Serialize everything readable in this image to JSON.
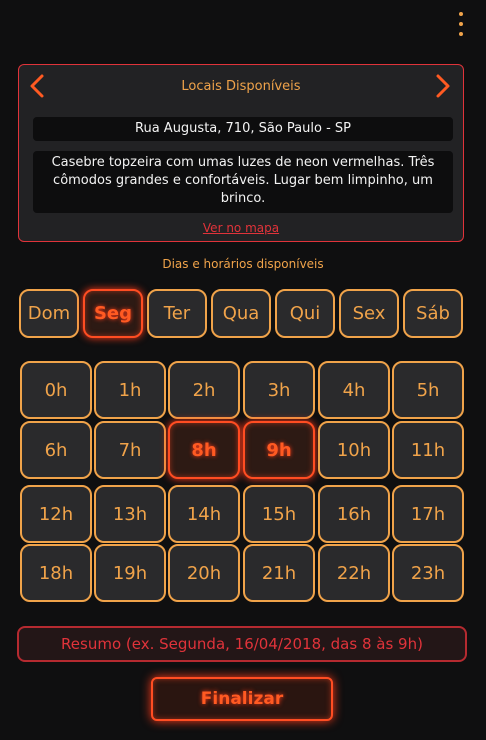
{
  "header": {
    "menu_icon": "kebab-menu-icon"
  },
  "locations": {
    "title": "Locais Disponíveis",
    "prev_icon": "chevron-left-icon",
    "next_icon": "chevron-right-icon",
    "address": "Rua Augusta, 710, São Paulo - SP",
    "description": "Casebre topzeira com umas luzes de neon vermelhas. Três cômodos grandes e confortáveis. Lugar bem limpinho, um brinco.",
    "map_link": "Ver no mapa"
  },
  "schedule": {
    "label": "Dias e horários disponíveis",
    "days": [
      {
        "label": "Dom",
        "selected": false
      },
      {
        "label": "Seg",
        "selected": true
      },
      {
        "label": "Ter",
        "selected": false
      },
      {
        "label": "Qua",
        "selected": false
      },
      {
        "label": "Qui",
        "selected": false
      },
      {
        "label": "Sex",
        "selected": false
      },
      {
        "label": "Sáb",
        "selected": false
      }
    ],
    "hours": [
      {
        "label": "0h",
        "selected": false
      },
      {
        "label": "1h",
        "selected": false
      },
      {
        "label": "2h",
        "selected": false
      },
      {
        "label": "3h",
        "selected": false
      },
      {
        "label": "4h",
        "selected": false
      },
      {
        "label": "5h",
        "selected": false
      },
      {
        "label": "6h",
        "selected": false
      },
      {
        "label": "7h",
        "selected": false
      },
      {
        "label": "8h",
        "selected": true
      },
      {
        "label": "9h",
        "selected": true
      },
      {
        "label": "10h",
        "selected": false
      },
      {
        "label": "11h",
        "selected": false
      },
      {
        "label": "12h",
        "selected": false
      },
      {
        "label": "13h",
        "selected": false
      },
      {
        "label": "14h",
        "selected": false
      },
      {
        "label": "15h",
        "selected": false
      },
      {
        "label": "16h",
        "selected": false
      },
      {
        "label": "17h",
        "selected": false
      },
      {
        "label": "18h",
        "selected": false
      },
      {
        "label": "19h",
        "selected": false
      },
      {
        "label": "20h",
        "selected": false
      },
      {
        "label": "21h",
        "selected": false
      },
      {
        "label": "22h",
        "selected": false
      },
      {
        "label": "23h",
        "selected": false
      }
    ]
  },
  "summary": "Resumo (ex. Segunda, 16/04/2018, das 8 às 9h)",
  "finish_label": "Finalizar",
  "colors": {
    "accent": "#f0a34a",
    "neon_red": "#ff4d22",
    "border_red": "#e0333a"
  }
}
